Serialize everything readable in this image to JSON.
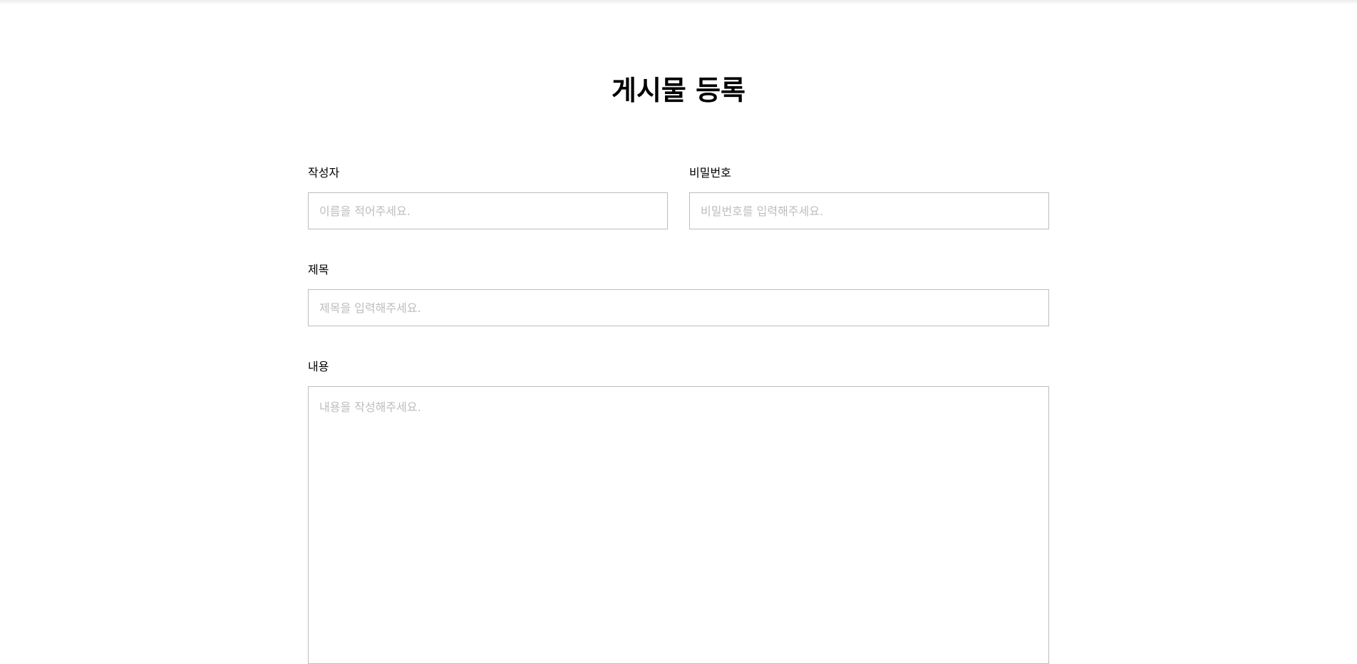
{
  "page": {
    "title": "게시물 등록"
  },
  "form": {
    "writer": {
      "label": "작성자",
      "placeholder": "이름을 적어주세요.",
      "value": ""
    },
    "password": {
      "label": "비밀번호",
      "placeholder": "비밀번호를 입력해주세요.",
      "value": ""
    },
    "subject": {
      "label": "제목",
      "placeholder": "제목을 입력해주세요.",
      "value": ""
    },
    "contents": {
      "label": "내용",
      "placeholder": "내용을 작성해주세요.",
      "value": ""
    }
  },
  "colors": {
    "border": "#bdbdbd",
    "placeholder": "#bdbdbd",
    "text": "#000000",
    "background": "#ffffff"
  }
}
